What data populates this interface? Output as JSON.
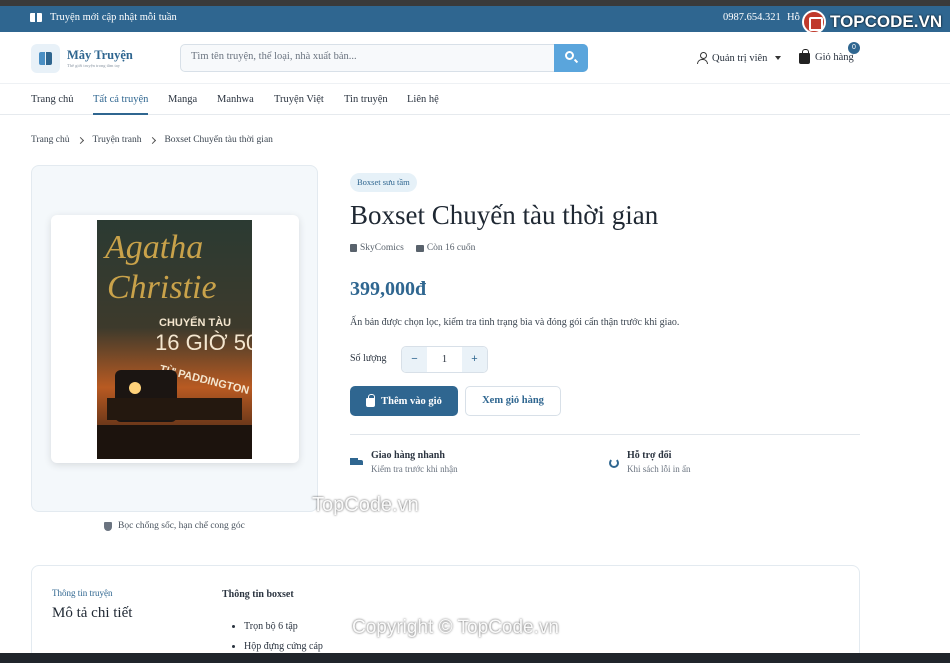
{
  "topbar": {
    "announcement": "Truyện mới cập nhật mỗi tuần",
    "phone": "0987.654.321",
    "support": "Hỗ"
  },
  "header": {
    "logo_name": "Mây Truyện",
    "logo_tagline": "Thế giới truyện trong tầm tay",
    "search_placeholder": "Tìm tên truyện, thể loại, nhà xuất bản...",
    "admin_label": "Quản trị viên",
    "cart_label": "Giỏ hàng",
    "cart_count": "0"
  },
  "nav": {
    "items": [
      {
        "label": "Trang chủ"
      },
      {
        "label": "Tất cả truyện"
      },
      {
        "label": "Manga"
      },
      {
        "label": "Manhwa"
      },
      {
        "label": "Truyện Việt"
      },
      {
        "label": "Tin truyện"
      },
      {
        "label": "Liên hệ"
      }
    ],
    "active": "Tất cả truyện"
  },
  "breadcrumb": {
    "items": [
      "Trang chủ",
      "Truyện tranh",
      "Boxset Chuyến tàu thời gian"
    ]
  },
  "product": {
    "cover": {
      "author_line1": "Agatha",
      "author_line2": "Christie",
      "title_line1": "CHUYẾN TÀU",
      "title_line2": "16 GIỜ 50",
      "title_line3": "TỪ PADDINGTON"
    },
    "image_note": "Bọc chống sốc, hạn chế cong góc",
    "badge": "Boxset sưu tầm",
    "title": "Boxset Chuyến tàu thời gian",
    "publisher": "SkyComics",
    "stock": "Còn 16 cuốn",
    "price": "399,000đ",
    "description": "Ấn bản được chọn lọc, kiểm tra tình trạng bìa và đóng gói cẩn thận trước khi giao.",
    "quantity_label": "Số lượng",
    "quantity": "1",
    "minus": "−",
    "plus": "+",
    "add_to_cart": "Thêm vào giỏ",
    "view_cart": "Xem giỏ hàng",
    "features": [
      {
        "title": "Giao hàng nhanh",
        "subtitle": "Kiểm tra trước khi nhận",
        "icon": "truck-icon"
      },
      {
        "title": "Hỗ trợ đổi",
        "subtitle": "Khi sách lỗi in ấn",
        "icon": "sync-icon"
      }
    ]
  },
  "details": {
    "kicker": "Thông tin truyện",
    "heading": "Mô tả chi tiết",
    "box_heading": "Thông tin boxset",
    "list": [
      "Trọn bộ 6 tập",
      "Hộp đựng cứng cáp"
    ]
  },
  "watermarks": {
    "top_right": "TOPCODE.VN",
    "middle": "TopCode.vn",
    "bottom": "Copyright © TopCode.vn"
  },
  "colors": {
    "primary": "#2f6690",
    "accent": "#5aa5dc",
    "topbar": "#2f6690"
  }
}
